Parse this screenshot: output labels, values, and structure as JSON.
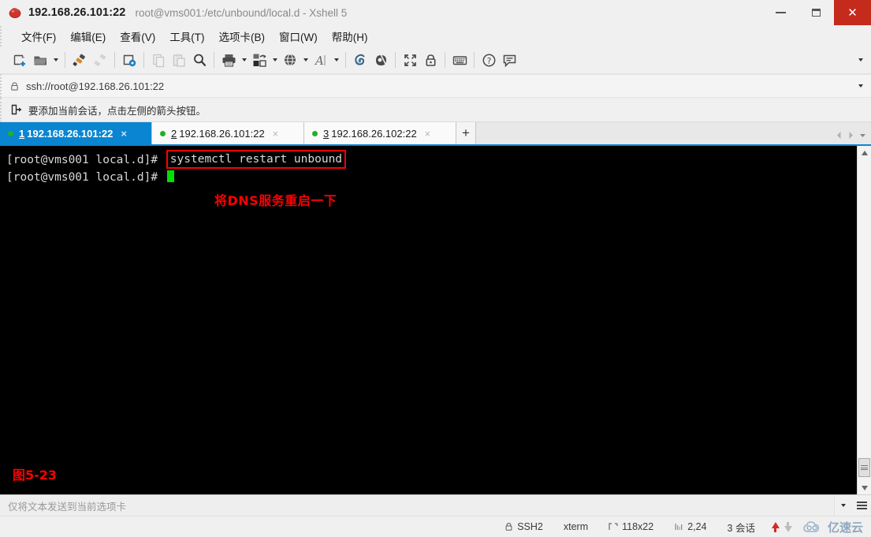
{
  "titlebar": {
    "app_icon": "xshell-icon",
    "host": "192.168.26.101:22",
    "subtitle": "root@vms001:/etc/unbound/local.d - Xshell 5",
    "controls": {
      "minimize": "minimize-button",
      "maximize": "restore-button",
      "close": "close-button"
    }
  },
  "menubar": {
    "items": [
      {
        "label": "文件(F)",
        "name": "menu-file"
      },
      {
        "label": "编辑(E)",
        "name": "menu-edit"
      },
      {
        "label": "查看(V)",
        "name": "menu-view"
      },
      {
        "label": "工具(T)",
        "name": "menu-tools"
      },
      {
        "label": "选项卡(B)",
        "name": "menu-tabs"
      },
      {
        "label": "窗口(W)",
        "name": "menu-window"
      },
      {
        "label": "帮助(H)",
        "name": "menu-help"
      }
    ]
  },
  "toolbar": {
    "buttons": [
      {
        "name": "new-session-icon",
        "caret": false,
        "disabled": false
      },
      {
        "name": "open-folder-icon",
        "caret": true,
        "disabled": false
      },
      {
        "name": "connect-icon",
        "caret": false,
        "disabled": false
      },
      {
        "name": "disconnect-icon",
        "caret": false,
        "disabled": true
      },
      {
        "name": "properties-icon",
        "caret": false,
        "disabled": false
      },
      {
        "name": "copy-icon",
        "caret": false,
        "disabled": true
      },
      {
        "name": "paste-icon",
        "caret": false,
        "disabled": true
      },
      {
        "name": "find-icon",
        "caret": false,
        "disabled": false
      },
      {
        "name": "print-icon",
        "caret": true,
        "disabled": false
      },
      {
        "name": "file-transfer-icon",
        "caret": true,
        "disabled": false
      },
      {
        "name": "globe-icon",
        "caret": true,
        "disabled": false
      },
      {
        "name": "font-size-icon",
        "caret": true,
        "disabled": false
      },
      {
        "name": "compose-bar-icon",
        "caret": false,
        "disabled": false
      },
      {
        "name": "highlight-icon",
        "caret": false,
        "disabled": false
      },
      {
        "name": "fullscreen-icon",
        "caret": false,
        "disabled": false
      },
      {
        "name": "lock-icon",
        "caret": false,
        "disabled": false
      },
      {
        "name": "keyboard-icon",
        "caret": false,
        "disabled": false
      },
      {
        "name": "help-icon",
        "caret": false,
        "disabled": false
      },
      {
        "name": "chat-icon",
        "caret": false,
        "disabled": false
      }
    ],
    "overflow_label": "toolbar-overflow"
  },
  "addressbar": {
    "lock_icon": "lock-icon",
    "url": "ssh://root@192.168.26.101:22",
    "dropdown": "address-dropdown-icon"
  },
  "noticebar": {
    "icon": "add-session-arrow-icon",
    "text": "要添加当前会话，点击左侧的箭头按钮。"
  },
  "tabs": {
    "items": [
      {
        "num": "1",
        "label": "192.168.26.101:22",
        "active": true,
        "close": "×"
      },
      {
        "num": "2",
        "label": "192.168.26.101:22",
        "active": false,
        "close": "×"
      },
      {
        "num": "3",
        "label": "192.168.26.102:22",
        "active": false,
        "close": "×"
      }
    ],
    "add_label": "+",
    "nav_prev": "tab-prev-icon",
    "nav_next": "tab-next-icon",
    "nav_list": "tab-list-icon"
  },
  "terminal": {
    "prompt1": "[root@vms001 local.d]# ",
    "command": "systemctl restart unbound",
    "prompt2": "[root@vms001 local.d]# ",
    "annotation": "将DNS服务重启一下",
    "figure_label": "图5-23",
    "highlight_color": "#ff0000",
    "cursor_color": "#00e000",
    "background": "#000000",
    "foreground": "#d8d8d8"
  },
  "sendbar": {
    "placeholder": "仅将文本发送到当前选项卡",
    "value": "",
    "dropdown": "send-target-dropdown-icon",
    "menu": "sendbar-menu-icon"
  },
  "statusbar": {
    "protocol_icon": "lock-icon",
    "protocol": "SSH2",
    "term_type": "xterm",
    "size_icon": "terminal-size-icon",
    "size": "118x22",
    "cursor_icon": "cursor-position-icon",
    "cursor_pos": "2,24",
    "sessions": "3 会话",
    "upload_icon": "upload-arrow-icon",
    "download_icon": "download-arrow-icon",
    "watermark": "亿速云",
    "watermark_icon": "cloud-logo-icon"
  },
  "colors": {
    "accent": "#0a85d1",
    "close_red": "#c42b1c",
    "annotation_red": "#ff0000",
    "tab_dot_green": "#23b024"
  }
}
